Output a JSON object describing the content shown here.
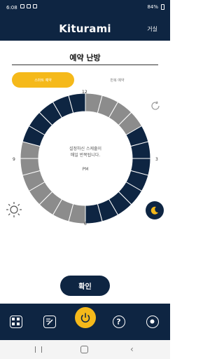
{
  "status_bar": {
    "time": "6:08",
    "battery": "84%"
  },
  "header": {
    "logo": "Kiturami",
    "room": "거실"
  },
  "page": {
    "title": "예약 난방"
  },
  "tabs": [
    {
      "label": "스마트 예약",
      "active": true
    },
    {
      "label": "반복 예약",
      "active": false
    }
  ],
  "dial": {
    "labels": {
      "n12": "12",
      "n3": "3",
      "n6": "6",
      "n9": "9"
    },
    "center_text_line1": "설정하신 스케줄이",
    "center_text_line2": "매일 반복됩니다.",
    "period": "PM",
    "segments": [
      false,
      false,
      false,
      false,
      true,
      true,
      true,
      true,
      true,
      true,
      true,
      true,
      false,
      false,
      false,
      false,
      false,
      false,
      false,
      true,
      true,
      true,
      true,
      true
    ],
    "colors": {
      "on": "#0e2542",
      "off": "#8c8c8c"
    }
  },
  "actions": {
    "confirm": "확인"
  },
  "bottom_nav": [
    "grid-icon",
    "edit-icon",
    "power-icon",
    "help-icon",
    "settings-icon"
  ],
  "colors": {
    "navy": "#0e2542",
    "accent": "#f5b91a"
  }
}
